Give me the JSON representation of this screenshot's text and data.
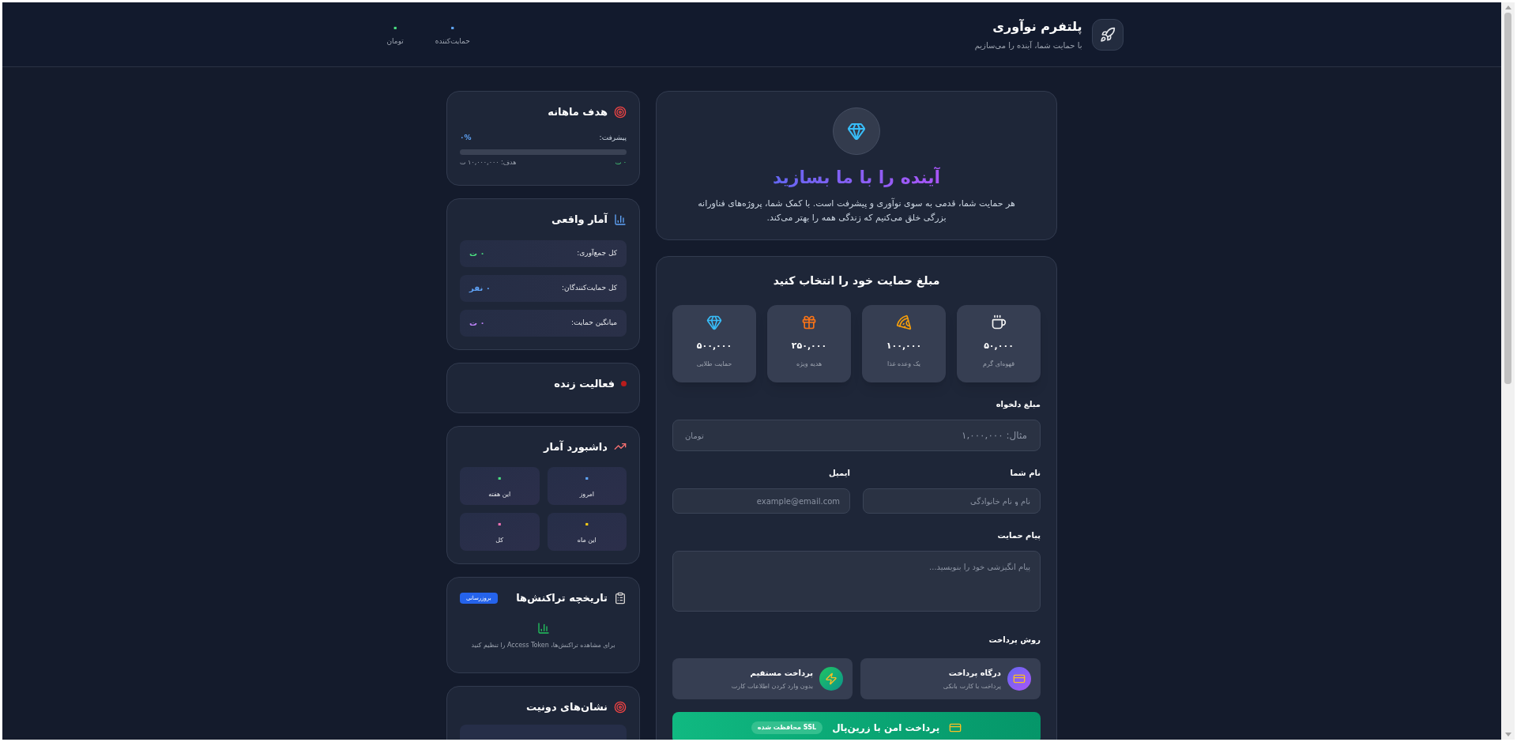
{
  "header": {
    "title": "پلتفرم نوآوری",
    "subtitle": "با حمایت شما، آینده را می‌سازیم",
    "stats": [
      {
        "value": "۰",
        "label": "حمایت‌کننده",
        "color": "#60a5fa"
      },
      {
        "value": "۰",
        "label": "تومان",
        "color": "#4ade80"
      }
    ]
  },
  "hero": {
    "title": "آینده را با ما بسازید",
    "text": "هر حمایت شما، قدمی به سوی نوآوری و پیشرفت است. با کمک شما، پروژه‌های فناورانه بزرگی خلق می‌کنیم که زندگی همه را بهتر می‌کند."
  },
  "donation": {
    "title": "مبلغ حمایت خود را انتخاب کنید",
    "amounts": [
      {
        "kind": "coffee",
        "amount": "۵۰,۰۰۰",
        "label": "قهوه‌ای گرم"
      },
      {
        "kind": "pizza",
        "amount": "۱۰۰,۰۰۰",
        "label": "یک وعده غذا"
      },
      {
        "kind": "gift",
        "amount": "۲۵۰,۰۰۰",
        "label": "هدیه ویژه"
      },
      {
        "kind": "gem",
        "amount": "۵۰۰,۰۰۰",
        "label": "حمایت طلایی"
      }
    ],
    "custom_amount": {
      "label": "مبلغ دلخواه",
      "placeholder": "مثال: ۱,۰۰۰,۰۰۰",
      "unit": "تومان"
    },
    "name": {
      "label": "نام شما",
      "placeholder": "نام و نام خانوادگی"
    },
    "email": {
      "label": "ایمیل",
      "placeholder": "example@email.com"
    },
    "message": {
      "label": "پیام حمایت",
      "placeholder": "پیام انگیزشی خود را بنویسید..."
    },
    "payment_title": "روش پرداخت",
    "payment_methods": [
      {
        "kind": "gateway",
        "title": "درگاه پرداخت",
        "subtitle": "پرداخت با کارت بانکی"
      },
      {
        "kind": "direct",
        "title": "پرداخت مستقیم",
        "subtitle": "بدون وارد کردن اطلاعات کارت"
      }
    ],
    "pay_button": {
      "label": "پرداخت امن با زرین‌پال",
      "badge": "SSL محافظت شده"
    }
  },
  "goal": {
    "title": "هدف ماهانه",
    "progress_label": "پیشرفت:",
    "percent": "۰%",
    "raised": "۰ ت",
    "target": "هدف: ۱۰,۰۰۰,۰۰۰ ت"
  },
  "stats": {
    "title": "آمار واقعی",
    "rows": [
      {
        "label": "کل جمع‌آوری:",
        "value": "۰ ت",
        "color": "#4ade80"
      },
      {
        "label": "کل حمایت‌کنندگان:",
        "value": "۰ نفر",
        "color": "#60a5fa"
      },
      {
        "label": "میانگین حمایت:",
        "value": "۰ ت",
        "color": "#c084fc"
      }
    ]
  },
  "live": {
    "title": "فعالیت زنده"
  },
  "dashboard": {
    "title": "داشبورد آمار",
    "tiles": [
      {
        "value": "۰",
        "label": "امروز",
        "color": "#60a5fa"
      },
      {
        "value": "۰",
        "label": "این هفته",
        "color": "#4ade80"
      },
      {
        "value": "۰",
        "label": "این ماه",
        "color": "#facc15"
      },
      {
        "value": "۰",
        "label": "کل",
        "color": "#f472b6"
      }
    ]
  },
  "history": {
    "title": "تاریخچه تراکنش‌ها",
    "refresh": "بروزرسانی",
    "empty_text": "برای مشاهده تراکنش‌ها، Access Token را تنظیم کنید"
  },
  "badges": {
    "title": "نشان‌های دونیت"
  }
}
